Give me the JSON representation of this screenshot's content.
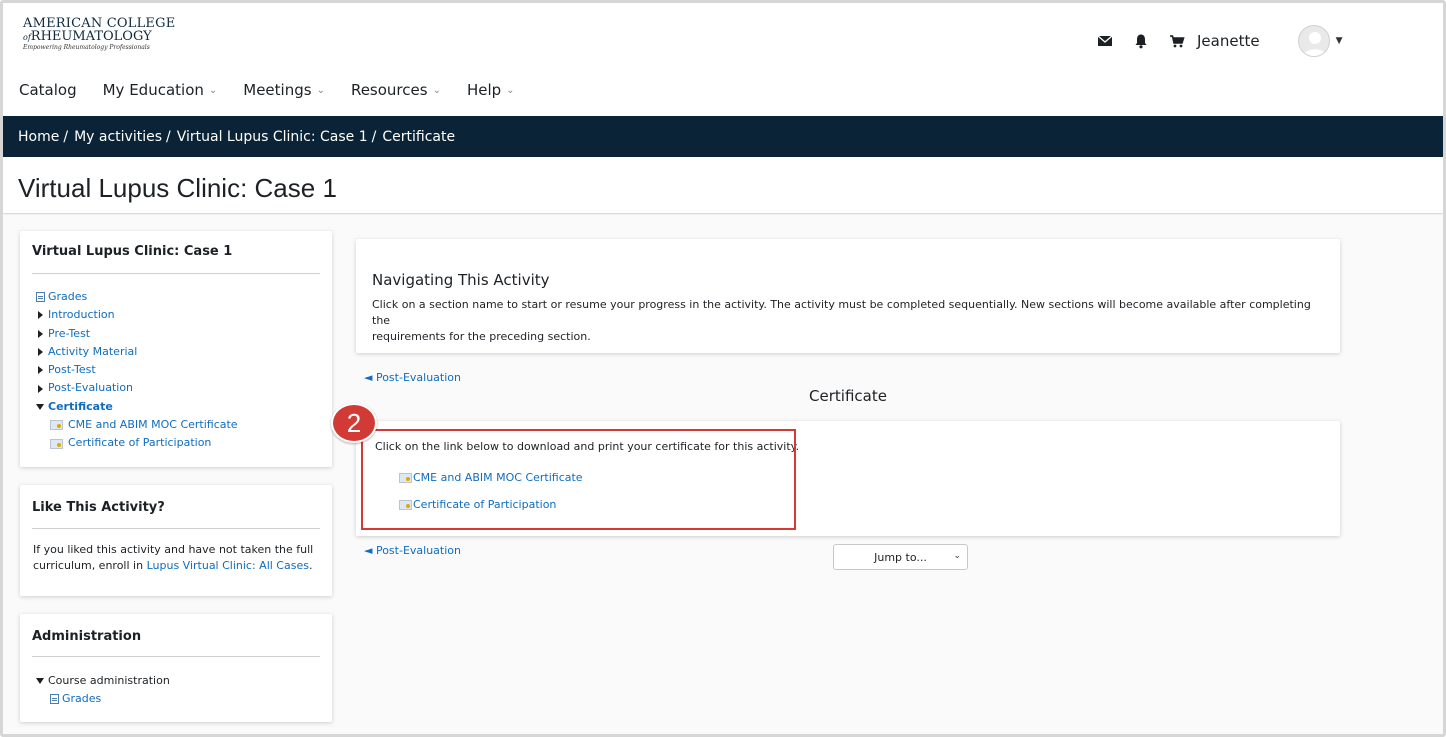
{
  "header": {
    "logo": {
      "line1": "AMERICAN COLLEGE",
      "line2_prefix": "of",
      "line2": "RHEUMATOLOGY",
      "tagline": "Empowering Rheumatology Professionals"
    },
    "icons": [
      "mail-icon",
      "bell-icon",
      "cart-icon"
    ],
    "username": "Jeanette",
    "nav": [
      {
        "label": "Catalog",
        "has_menu": false
      },
      {
        "label": "My Education",
        "has_menu": true
      },
      {
        "label": "Meetings",
        "has_menu": true
      },
      {
        "label": "Resources",
        "has_menu": true
      },
      {
        "label": "Help",
        "has_menu": true
      }
    ]
  },
  "breadcrumb": [
    "Home",
    "My activities",
    "Virtual Lupus Clinic: Case 1",
    "Certificate"
  ],
  "page_title": "Virtual Lupus Clinic: Case 1",
  "sidebar": {
    "course_block": {
      "title": "Virtual Lupus Clinic: Case 1",
      "grades": "Grades",
      "sections": [
        "Introduction",
        "Pre-Test",
        "Activity Material",
        "Post-Test",
        "Post-Evaluation"
      ],
      "current_section": "Certificate",
      "sub_items": [
        "CME and ABIM MOC Certificate",
        "Certificate of Participation"
      ]
    },
    "like_block": {
      "title": "Like This Activity?",
      "text_line1": "If you liked this activity and have not taken the full",
      "text_line2_prefix": "curriculum, enroll in",
      "link": "Lupus Virtual Clinic: All Cases",
      "text_suffix": "."
    },
    "admin_block": {
      "title": "Administration",
      "course_admin": "Course administration",
      "grades": "Grades"
    }
  },
  "main": {
    "nav_card": {
      "title": "Navigating This Activity",
      "text_line1": "Click on a section name to start or resume your progress in the activity. The activity must be completed sequentially. New sections will become available after completing the",
      "text_line2": "requirements for the preceding section."
    },
    "prev_link": "◄ Post-Evaluation",
    "section_title": "Certificate",
    "instruction": "Click on the link below to download and print your certificate for this activity.",
    "cert_links": [
      "CME and ABIM MOC Certificate",
      "Certificate of Participation"
    ],
    "badge_number": "2",
    "jump_to": "Jump to..."
  },
  "colors": {
    "navy": "#0b2336",
    "link": "#0f6cbf",
    "highlight": "#d23b35"
  }
}
